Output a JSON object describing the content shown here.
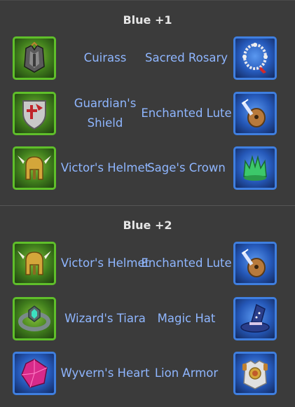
{
  "sections": [
    {
      "title": "Blue +1",
      "rows": [
        {
          "left": {
            "name": "Cuirass",
            "icon": "cuirass-icon",
            "frame": "green"
          },
          "right": {
            "name": "Sacred Rosary",
            "icon": "rosary-icon",
            "frame": "blue"
          }
        },
        {
          "left": {
            "name": "Guardian's Shield",
            "icon": "shield-icon",
            "frame": "green"
          },
          "right": {
            "name": "Enchanted Lute",
            "icon": "lute-icon",
            "frame": "blue"
          }
        },
        {
          "left": {
            "name": "Victor's Helmet",
            "icon": "helmet-icon",
            "frame": "green"
          },
          "right": {
            "name": "Sage's Crown",
            "icon": "crown-icon",
            "frame": "blue"
          }
        }
      ]
    },
    {
      "title": "Blue +2",
      "rows": [
        {
          "left": {
            "name": "Victor's Helmet",
            "icon": "helmet-icon",
            "frame": "green"
          },
          "right": {
            "name": "Enchanted Lute",
            "icon": "lute-icon",
            "frame": "blue"
          }
        },
        {
          "left": {
            "name": "Wizard's Tiara",
            "icon": "tiara-icon",
            "frame": "green"
          },
          "right": {
            "name": "Magic Hat",
            "icon": "wizard-hat-icon",
            "frame": "blue"
          }
        },
        {
          "left": {
            "name": "Wyvern's Heart",
            "icon": "gem-icon",
            "frame": "blue"
          },
          "right": {
            "name": "Lion Armor",
            "icon": "lion-armor-icon",
            "frame": "blue"
          }
        }
      ]
    }
  ],
  "colors": {
    "background": "#3b3b3b",
    "title": "#e6e6e6",
    "item_label": "#8fb6ff",
    "frame_green": "#5fbf2a",
    "frame_blue": "#3f7fe0"
  }
}
